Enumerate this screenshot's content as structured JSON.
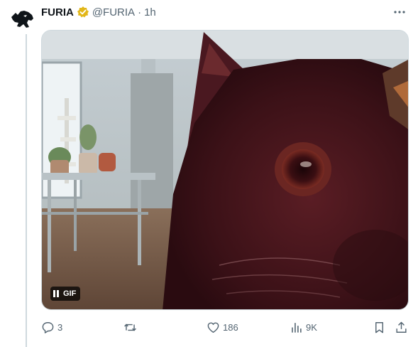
{
  "tweet": {
    "display_name": "FURIA",
    "handle": "@FURIA",
    "separator": "·",
    "time": "1h",
    "media": {
      "type": "gif",
      "badge_label": "GIF",
      "playback": "playing"
    }
  },
  "actions": {
    "replies": "3",
    "retweets": "",
    "likes": "186",
    "views": "9K"
  },
  "colors": {
    "verified_badge": "#e2b719",
    "secondary_text": "#536471",
    "primary_text": "#0f1419"
  },
  "icons": [
    "furia-panther-logo",
    "verified-badge-icon",
    "more-icon",
    "pause-icon",
    "reply-icon",
    "retweet-icon",
    "like-icon",
    "views-icon",
    "bookmark-icon",
    "share-icon"
  ]
}
